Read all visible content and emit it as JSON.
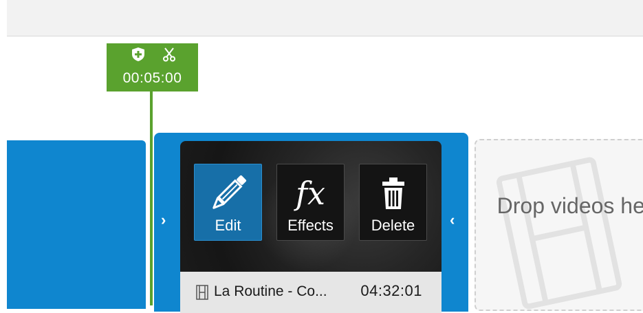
{
  "playhead": {
    "time": "00:05:00",
    "icons": [
      "add-marker-icon",
      "split-scissors-icon"
    ]
  },
  "clip": {
    "name": "La Routine - Co...",
    "duration": "04:32:01",
    "trim_left_glyph": "›",
    "trim_right_glyph": "‹",
    "actions": {
      "edit": "Edit",
      "effects": "Effects",
      "effects_glyph": "fx",
      "delete": "Delete"
    }
  },
  "drop_zone": {
    "text": "Drop videos here"
  },
  "colors": {
    "accent_blue": "#0f86cf",
    "playhead_green": "#5aa22e",
    "edit_active": "#176fa8"
  }
}
